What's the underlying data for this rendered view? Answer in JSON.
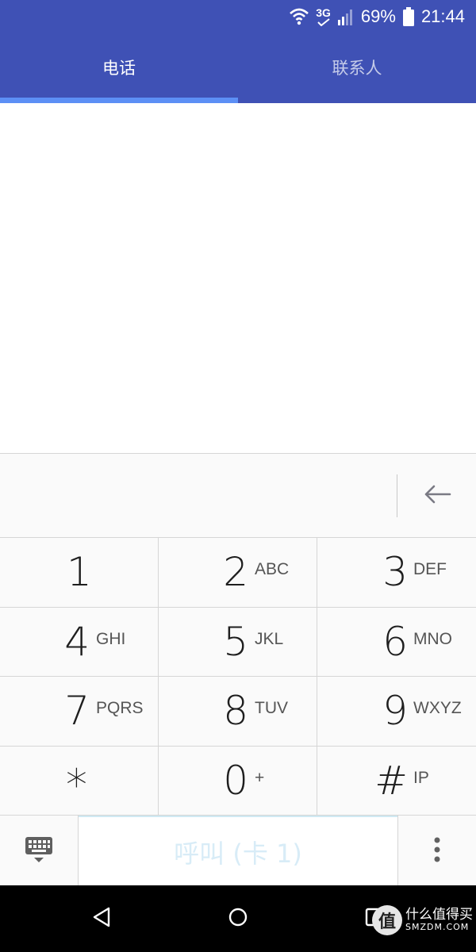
{
  "status_bar": {
    "network": "3G",
    "battery": "69%",
    "time": "21:44",
    "icons": [
      "wifi-icon",
      "network-3g-icon",
      "signal-icon",
      "battery-icon"
    ]
  },
  "tabs": [
    {
      "label": "电话",
      "active": true
    },
    {
      "label": "联系人",
      "active": false
    }
  ],
  "dialer": {
    "number": "",
    "keys": [
      {
        "digit": "1",
        "letters": ""
      },
      {
        "digit": "2",
        "letters": "ABC"
      },
      {
        "digit": "3",
        "letters": "DEF"
      },
      {
        "digit": "4",
        "letters": "GHI"
      },
      {
        "digit": "5",
        "letters": "JKL"
      },
      {
        "digit": "6",
        "letters": "MNO"
      },
      {
        "digit": "7",
        "letters": "PQRS"
      },
      {
        "digit": "8",
        "letters": "TUV"
      },
      {
        "digit": "9",
        "letters": "WXYZ"
      },
      {
        "digit": "*",
        "letters": ""
      },
      {
        "digit": "0",
        "letters": "+"
      },
      {
        "digit": "#",
        "letters": "IP"
      }
    ],
    "call_label": "呼叫 (卡 1)"
  },
  "nav_icons": [
    "back-icon",
    "home-icon",
    "recents-icon"
  ],
  "watermark": {
    "cn": "什么值得买",
    "en": "SMZDM.COM",
    "badge": "值"
  },
  "colors": {
    "app_bar": "#3f51b5",
    "tab_indicator": "#5c8ff5",
    "call_text": "#d8ecf7"
  }
}
